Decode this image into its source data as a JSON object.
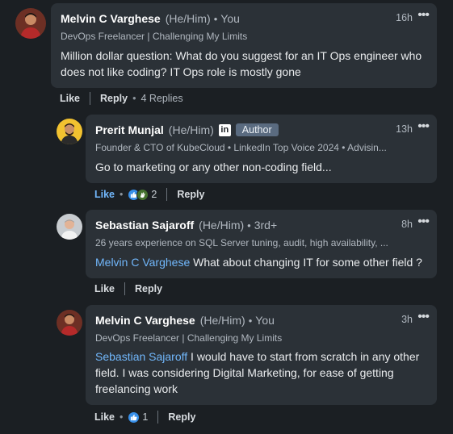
{
  "comments": [
    {
      "name": "Melvin C Varghese",
      "pronouns": "(He/Him)",
      "degree": "You",
      "headline": "DevOps Freelancer | Challenging My Limits",
      "time": "16h",
      "text": "Million dollar question: What do you suggest for an IT Ops engineer who does not like coding? IT Ops role is mostly gone",
      "like_label": "Like",
      "reply_label": "Reply",
      "replies_label": "4 Replies"
    },
    {
      "name": "Prerit Munjal",
      "pronouns": "(He/Him)",
      "li_badge": "in",
      "author_badge": "Author",
      "headline": "Founder & CTO of KubeCloud • LinkedIn Top Voice 2024 • Advisin...",
      "time": "13h",
      "text": "Go to marketing or any other non-coding field...",
      "like_label": "Like",
      "reaction_count": "2",
      "reply_label": "Reply"
    },
    {
      "name": "Sebastian Sajaroff",
      "pronouns": "(He/Him)",
      "degree": "3rd+",
      "headline": "26 years experience on SQL Server tuning, audit, high availability, ...",
      "time": "8h",
      "mention": "Melvin C Varghese",
      "text": " What about changing IT for some other field ?",
      "like_label": "Like",
      "reply_label": "Reply"
    },
    {
      "name": "Melvin C Varghese",
      "pronouns": "(He/Him)",
      "degree": "You",
      "headline": "DevOps Freelancer | Challenging My Limits",
      "time": "3h",
      "mention": "Sebastian Sajaroff",
      "text": " I would have to start from scratch in any other field. I was considering Digital Marketing, for ease of getting freelancing work",
      "like_label": "Like",
      "reaction_count": "1",
      "reply_label": "Reply"
    }
  ],
  "more_label": "•••",
  "dot": "•",
  "colors": {
    "background": "#1b1f23",
    "bubble": "#2b3137",
    "link": "#71b7fb",
    "like_reaction": "#378fe9",
    "celebrate_reaction": "#44712e"
  },
  "icons": {
    "more": "ellipsis-icon",
    "linkedin": "linkedin-premium-icon",
    "like_reaction": "thumbs-up-icon",
    "celebrate_reaction": "clapping-hands-icon"
  }
}
